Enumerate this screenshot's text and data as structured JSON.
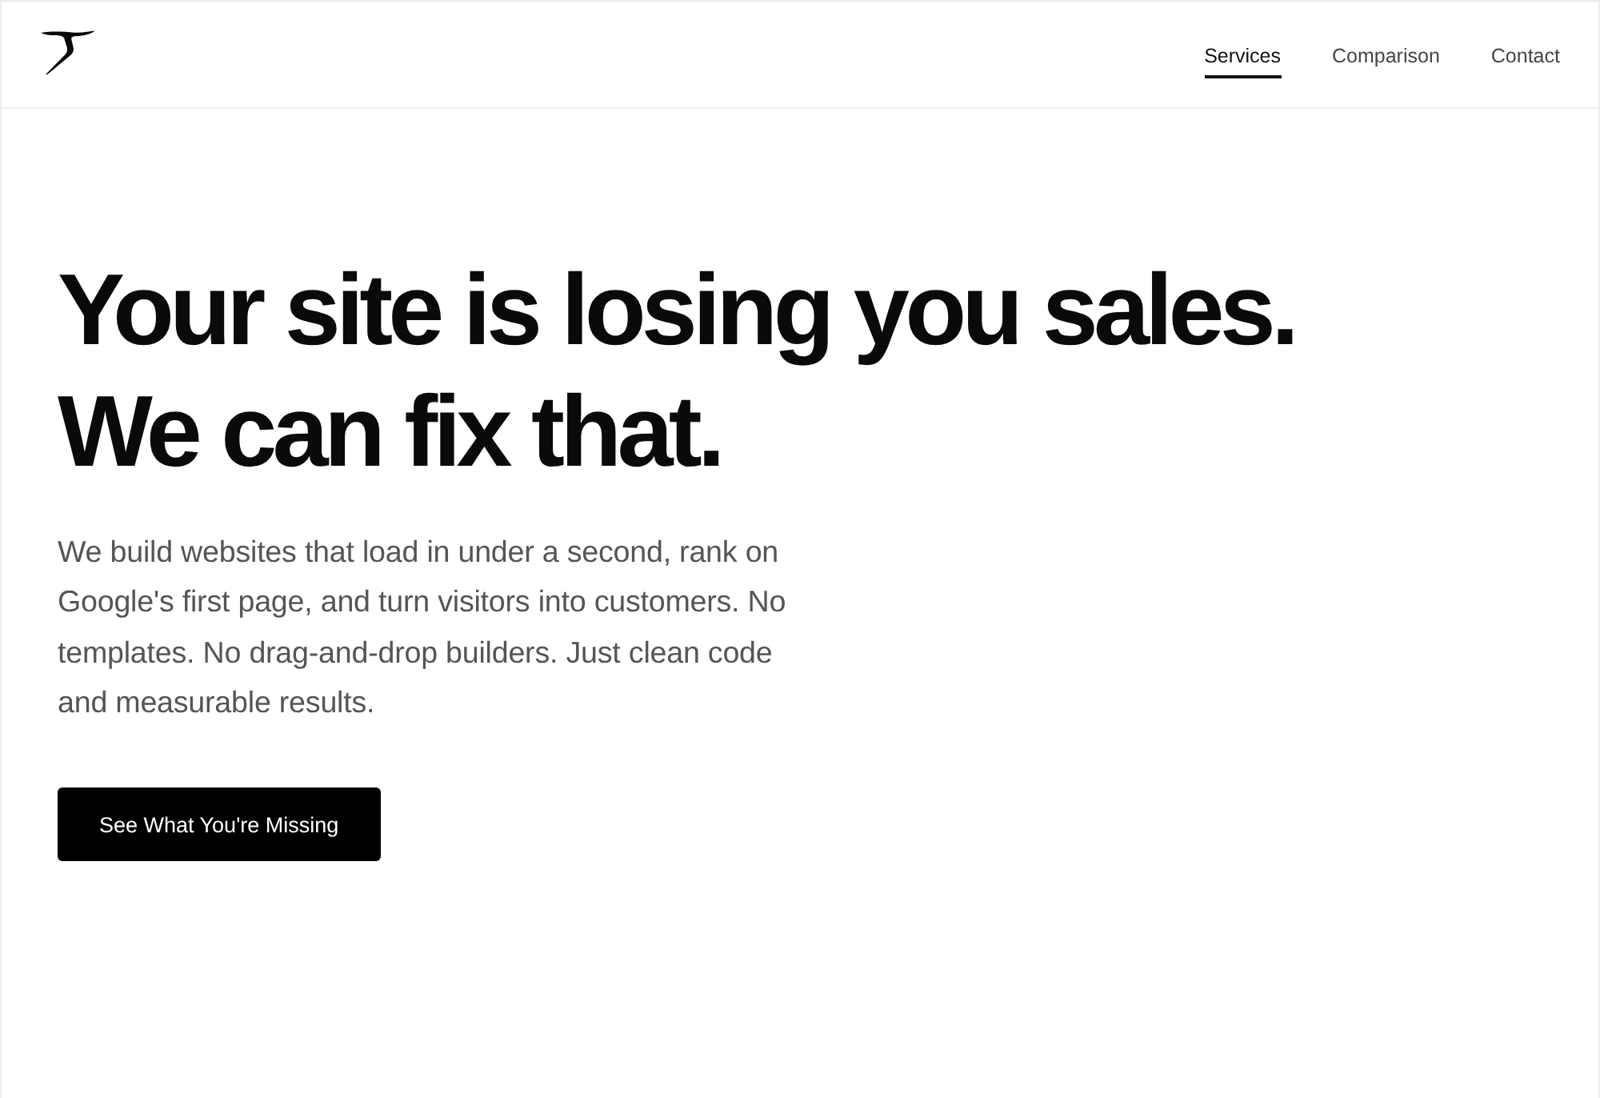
{
  "header": {
    "nav": [
      {
        "label": "Services",
        "selected": true
      },
      {
        "label": "Comparison",
        "selected": false
      },
      {
        "label": "Contact",
        "selected": false
      }
    ]
  },
  "hero": {
    "headline": [
      "Your site is losing you sales.",
      "We can fix that."
    ],
    "description": "We build websites that load in under a second, rank on Google's first page, and turn visitors into customers. No templates. No drag-and-drop builders. Just clean code and measurable results.",
    "cta": "See What You're Missing"
  }
}
